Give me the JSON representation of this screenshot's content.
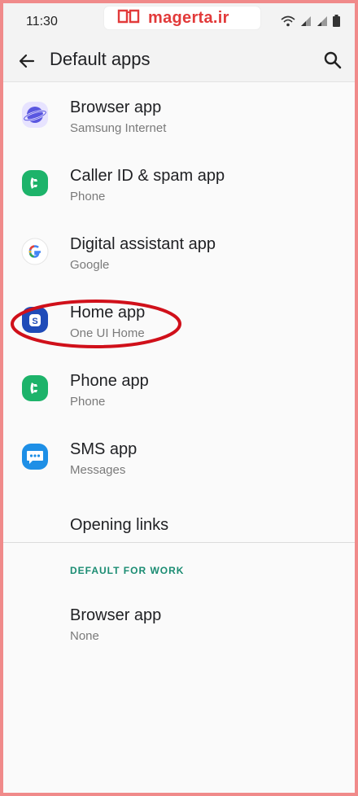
{
  "status": {
    "time": "11:30"
  },
  "watermark": {
    "text": "magerta.ir"
  },
  "appbar": {
    "title": "Default apps"
  },
  "items": [
    {
      "label": "Browser app",
      "sub": "Samsung Internet",
      "icon": "samsung-internet-icon"
    },
    {
      "label": "Caller ID & spam app",
      "sub": "Phone",
      "icon": "phone-app-icon"
    },
    {
      "label": "Digital assistant app",
      "sub": "Google",
      "icon": "google-icon"
    },
    {
      "label": "Home app",
      "sub": "One UI Home",
      "icon": "one-ui-home-icon"
    },
    {
      "label": "Phone app",
      "sub": "Phone",
      "icon": "phone-app-icon"
    },
    {
      "label": "SMS app",
      "sub": "Messages",
      "icon": "messages-icon"
    },
    {
      "label": "Opening links"
    }
  ],
  "work": {
    "section_title": "DEFAULT FOR WORK",
    "browser_label": "Browser app",
    "browser_sub": "None"
  },
  "colors": {
    "accent_green": "#1a8c72",
    "highlight_red": "#d0101a"
  }
}
